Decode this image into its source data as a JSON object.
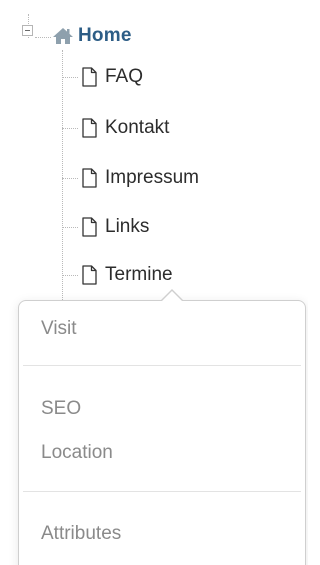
{
  "tree": {
    "root": {
      "label": "Home",
      "icon": "home-icon",
      "expanded": true,
      "color": "#2d5d86"
    },
    "children": [
      {
        "label": "FAQ",
        "icon": "page-icon"
      },
      {
        "label": "Kontakt",
        "icon": "page-icon"
      },
      {
        "label": "Impressum",
        "icon": "page-icon"
      },
      {
        "label": "Links",
        "icon": "page-icon"
      },
      {
        "label": "Termine",
        "icon": "page-icon"
      }
    ]
  },
  "context_menu": {
    "groups": [
      {
        "items": [
          {
            "label": "Visit"
          }
        ]
      },
      {
        "items": [
          {
            "label": "SEO"
          },
          {
            "label": "Location"
          }
        ]
      },
      {
        "items": [
          {
            "label": "Attributes"
          }
        ]
      }
    ],
    "text_color": "#8a8a8a"
  }
}
